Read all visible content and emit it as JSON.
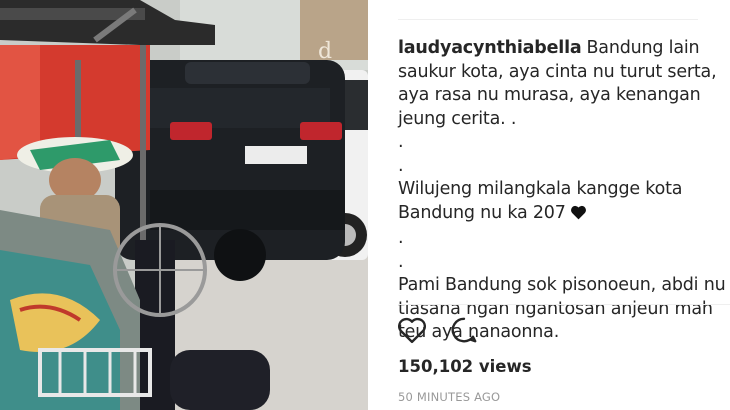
{
  "post": {
    "username": "laudyacynthiabella",
    "caption_lead": "Bandung lain saukur kota, aya cinta nu turut serta, aya rasa nu murasa, aya kenangan jeung cerita. .",
    "dot1": ".",
    "dot2": ".",
    "para2": "Wilujeng milangkala kangge kota Bandung nu ka 207",
    "dot3": ".",
    "dot4": ".",
    "para3": "Pami Bandung sok pisonoeun, abdi nu tiasana ngan ngantosan anjeun mah teu aya nanaonna.",
    "heart_emoji_icon": "black-heart-icon"
  },
  "actions": {
    "like_icon": "heart-outline-icon",
    "comment_icon": "comment-bubble-icon"
  },
  "stats": {
    "views": "150,102 views",
    "timestamp": "50 MINUTES AGO"
  },
  "colors": {
    "text": "#262626",
    "muted": "#999999",
    "divider": "#efefef"
  }
}
